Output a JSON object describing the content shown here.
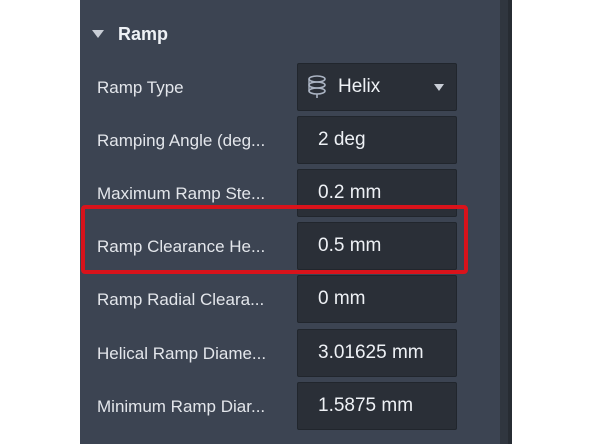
{
  "section": {
    "title": "Ramp"
  },
  "rows": [
    {
      "label": "Ramp Type",
      "value": "Helix",
      "icon": "helix-icon"
    },
    {
      "label": "Ramping Angle (deg...",
      "value": "2 deg"
    },
    {
      "label": "Maximum Ramp Ste...",
      "value": "0.2 mm"
    },
    {
      "label": "Ramp Clearance He...",
      "value": "0.5 mm"
    },
    {
      "label": "Ramp Radial Cleara...",
      "value": "0 mm"
    },
    {
      "label": "Helical Ramp Diame...",
      "value": "3.01625 mm"
    },
    {
      "label": "Minimum Ramp Diar...",
      "value": "1.5875 mm"
    }
  ],
  "highlight": {
    "color": "#d9131b",
    "target": "Ramp Clearance He..."
  },
  "colors": {
    "panel": "#3c4452",
    "field": "#2a2f37",
    "text": "#e3e6eb"
  }
}
